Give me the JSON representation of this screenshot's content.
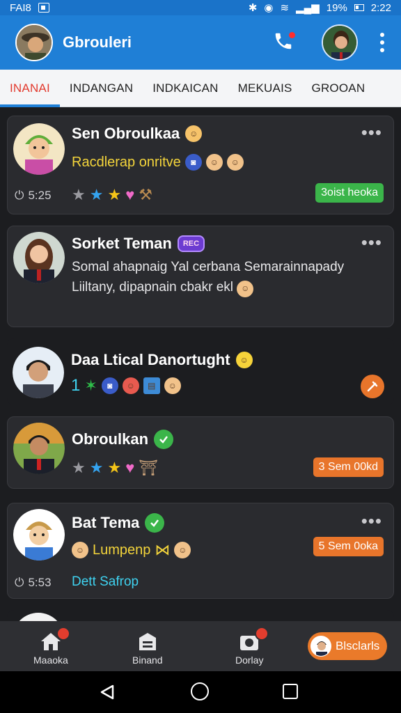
{
  "status_bar": {
    "carrier": "FAI8",
    "battery": "19%",
    "time": "2:22"
  },
  "app_bar": {
    "title": "Gbrouleri"
  },
  "tabs": [
    {
      "label": "INANAI",
      "active": true
    },
    {
      "label": "INDANGAN",
      "active": false
    },
    {
      "label": "INDKAICAN",
      "active": false
    },
    {
      "label": "MEKUAIS",
      "active": false
    },
    {
      "label": "GROOAN",
      "active": false
    }
  ],
  "chats": [
    {
      "name": "Sen Obroulkaa",
      "subtitle": "Racdlerap onritve",
      "time": "5:25",
      "status_pill": "3oist heoka",
      "status_color": "#3bb54a"
    },
    {
      "name": "Sorket Teman",
      "badge": "REC",
      "message": "Somal ahapnaig Yal cerbana Semarainnapady Liiltany, dipapnain cbakr ekl"
    },
    {
      "name": "Daa Ltical Danortught",
      "count": "1"
    },
    {
      "name": "Obroulkan",
      "status_pill": "3 Sem 00kd",
      "status_color": "#e8752b"
    },
    {
      "name": "Bat Tema",
      "subtitle": "Lumpenp",
      "time": "5:53",
      "preview": "Dett Safrop",
      "status_pill": "5 Sem 0oka",
      "status_color": "#e8752b"
    }
  ],
  "bottom_nav": {
    "items": [
      {
        "label": "Maaoka",
        "icon": "home-icon"
      },
      {
        "label": "Binand",
        "icon": "archive-icon"
      },
      {
        "label": "Dorlay",
        "icon": "camera-icon"
      }
    ],
    "cta_label": "Blsclarls"
  },
  "colors": {
    "app_bar": "#1f7fd6",
    "active_tab": "#e23a2e",
    "green": "#3bb54a",
    "orange": "#e8752b",
    "highlight_text": "#f4d53b",
    "link_text": "#3fd2f0"
  }
}
